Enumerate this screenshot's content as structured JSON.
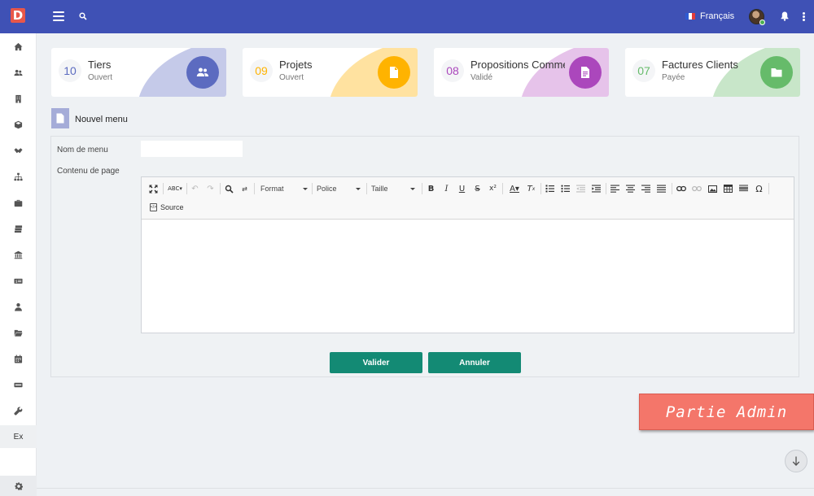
{
  "app": {
    "logo_letter": "D",
    "language": "Français"
  },
  "sidebar": {
    "items": [
      {
        "icon": "home-icon"
      },
      {
        "icon": "users-icon"
      },
      {
        "icon": "building-icon"
      },
      {
        "icon": "box-icon"
      },
      {
        "icon": "handshake-icon"
      },
      {
        "icon": "sitemap-icon"
      },
      {
        "icon": "briefcase-icon"
      },
      {
        "icon": "stacked-money-icon"
      },
      {
        "icon": "bank-icon"
      },
      {
        "icon": "cash-icon"
      },
      {
        "icon": "user-tie-icon"
      },
      {
        "icon": "folder-open-icon"
      },
      {
        "icon": "calendar-icon"
      },
      {
        "icon": "server-icon"
      },
      {
        "icon": "wrench-icon"
      }
    ],
    "ex_label": "Ex"
  },
  "cards": [
    {
      "number": "10",
      "title": "Tiers",
      "subtitle": "Ouvert",
      "icon": "users-icon",
      "color": "#5c6bc0",
      "blob": "#c5cae9"
    },
    {
      "number": "09",
      "title": "Projets",
      "subtitle": "Ouvert",
      "icon": "document-icon",
      "color": "#ffb300",
      "blob": "#ffe2a0"
    },
    {
      "number": "08",
      "title": "Propositions Comme",
      "subtitle": "Validé",
      "icon": "file-text-icon",
      "color": "#ab47bc",
      "blob": "#e6c3ea"
    },
    {
      "number": "07",
      "title": "Factures Clients",
      "subtitle": "Payée",
      "icon": "folder-icon",
      "color": "#66bb6a",
      "blob": "#c8e6c9"
    }
  ],
  "page": {
    "title": "Nouvel menu"
  },
  "form": {
    "menu_name_label": "Nom de menu",
    "menu_name_value": "",
    "content_label": "Contenu de page"
  },
  "editor": {
    "format_label": "Format",
    "font_label": "Police",
    "size_label": "Taille",
    "source_label": "Source"
  },
  "buttons": {
    "submit_label": "Valider",
    "cancel_label": "Annuler"
  },
  "badge": {
    "text": "Partie Admin"
  },
  "colors": {
    "topbar": "#3f51b5",
    "primary_button": "#138a74",
    "admin_badge": "#f4766a"
  }
}
